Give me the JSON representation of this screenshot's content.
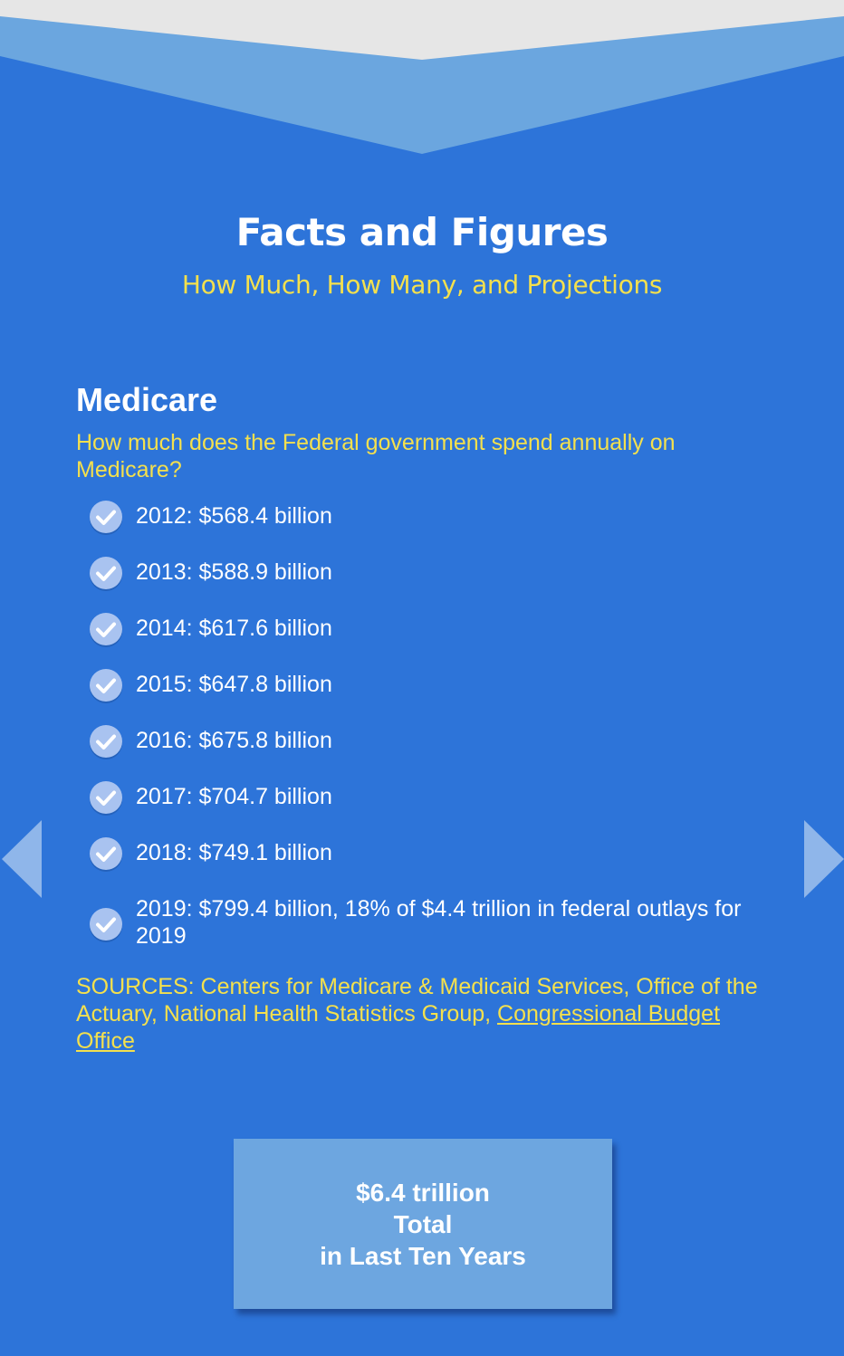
{
  "colors": {
    "background": "#2d74d9",
    "banner_light": "#e6e6e6",
    "banner_accent": "#6ba6df",
    "accent_yellow": "#f4e04d",
    "check_circle": "#a9c3f0"
  },
  "header": {
    "title": "Facts and Figures",
    "subtitle": "How Much, How Many, and Projections"
  },
  "section": {
    "title": "Medicare",
    "question": "How much does the Federal government spend annually on Medicare?",
    "facts": [
      "2012: $568.4 billion",
      "2013: $588.9 billion",
      "2014: $617.6 billion",
      "2015: $647.8 billion",
      "2016: $675.8 billion",
      "2017: $704.7 billion",
      "2018: $749.1 billion",
      "2019: $799.4 billion, 18% of $4.4 trillion in federal outlays for 2019"
    ],
    "check_icon": "check-circle-icon"
  },
  "sources": {
    "prefix": "SOURCES: Centers for Medicare & Medicaid Services, Office of the Actuary, National Health Statistics Group, ",
    "link_label": "Congressional Budget Office"
  },
  "total": {
    "line1": "$6.4 trillion",
    "line2": "Total",
    "line3": "in Last Ten Years"
  },
  "nav": {
    "prev_icon": "arrow-left-icon",
    "next_icon": "arrow-right-icon"
  }
}
